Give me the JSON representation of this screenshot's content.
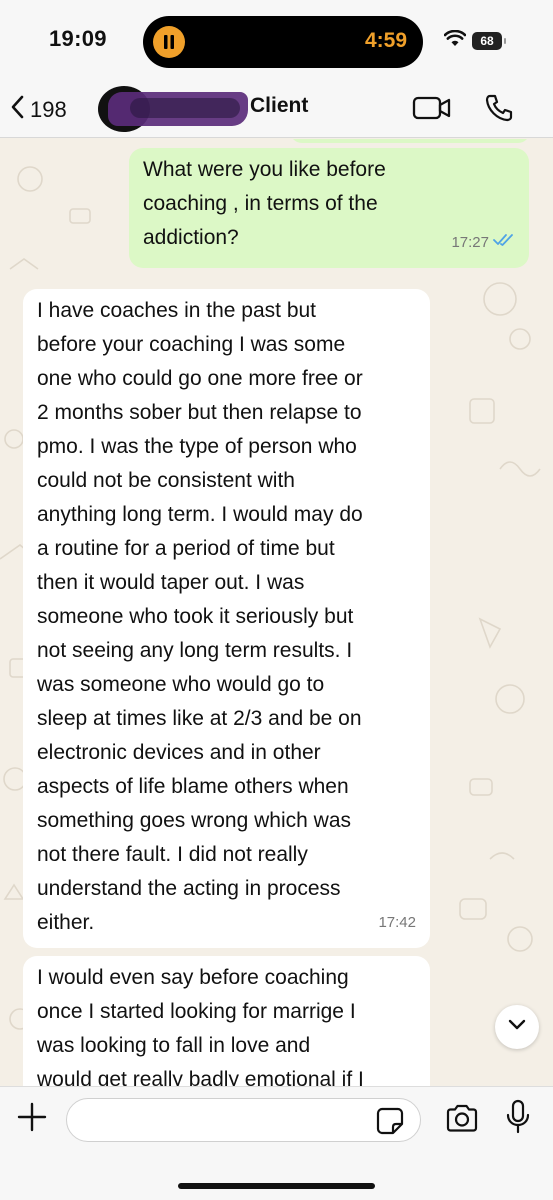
{
  "status_bar": {
    "time": "19:09",
    "activity_timer": "4:59",
    "battery": "68"
  },
  "header": {
    "back_count": "198",
    "contact_name_visible": "Client"
  },
  "messages": [
    {
      "direction": "outgoing",
      "text": "What were you like before coaching , in terms of the addiction?",
      "lines": [
        "What were you like before",
        "coaching , in terms of the",
        "addiction?"
      ],
      "time": "17:27",
      "read": true
    },
    {
      "direction": "incoming",
      "lines": [
        "I have coaches in the past but",
        "before your coaching I was some",
        "one who could go one more free or",
        "2 months sober but then relapse to",
        "pmo. I was the type of person who",
        "could not be consistent with",
        "anything long term. I would may do",
        "a routine for a period of time but",
        "then it would taper out. I was",
        "someone who took it seriously but",
        "not seeing any long term results. I",
        "was someone who would go to",
        "sleep at times like at 2/3 and be on",
        "electronic devices and in other",
        "aspects of life blame others when",
        "something goes wrong which was",
        "not there fault. I did not really",
        "understand the acting in process",
        "either."
      ],
      "time": "17:42"
    },
    {
      "direction": "incoming",
      "lines": [
        "I would even say before coaching",
        "once I started looking for marrige I",
        "was looking to fall in love and",
        "would get really badly emotional if I"
      ]
    }
  ],
  "composer": {
    "value": "",
    "placeholder": ""
  },
  "colors": {
    "outgoing_bubble": "#dcf8c6",
    "incoming_bubble": "#ffffff",
    "wallpaper": "#f4efe6",
    "read_ticks": "#4fa3e6",
    "activity_accent": "#f0a02a"
  },
  "icons": {
    "back": "chevron-left-icon",
    "video": "video-camera-icon",
    "call": "phone-icon",
    "attach": "plus-icon",
    "sticker": "sticker-icon",
    "camera": "camera-icon",
    "mic": "microphone-icon",
    "scroll": "chevron-down-icon"
  }
}
